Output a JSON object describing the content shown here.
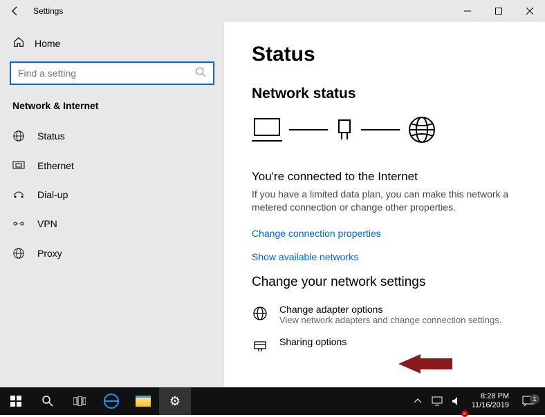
{
  "window": {
    "title": "Settings"
  },
  "sidebar": {
    "home": "Home",
    "search_placeholder": "Find a setting",
    "category": "Network & Internet",
    "items": [
      {
        "icon": "globe",
        "label": "Status"
      },
      {
        "icon": "ethernet",
        "label": "Ethernet"
      },
      {
        "icon": "dialup",
        "label": "Dial-up"
      },
      {
        "icon": "vpn",
        "label": "VPN"
      },
      {
        "icon": "globe",
        "label": "Proxy"
      }
    ]
  },
  "content": {
    "page_title": "Status",
    "network_status_heading": "Network status",
    "connected_title": "You're connected to the Internet",
    "connected_desc": "If you have a limited data plan, you can make this network a metered connection or change other properties.",
    "link_change_conn": "Change connection properties",
    "link_show_networks": "Show available networks",
    "change_settings_heading": "Change your network settings",
    "adapter_title": "Change adapter options",
    "adapter_desc": "View network adapters and change connection settings.",
    "sharing_title": "Sharing options"
  },
  "taskbar": {
    "time": "8:28 PM",
    "date": "11/16/2019",
    "notif_count": "1"
  }
}
